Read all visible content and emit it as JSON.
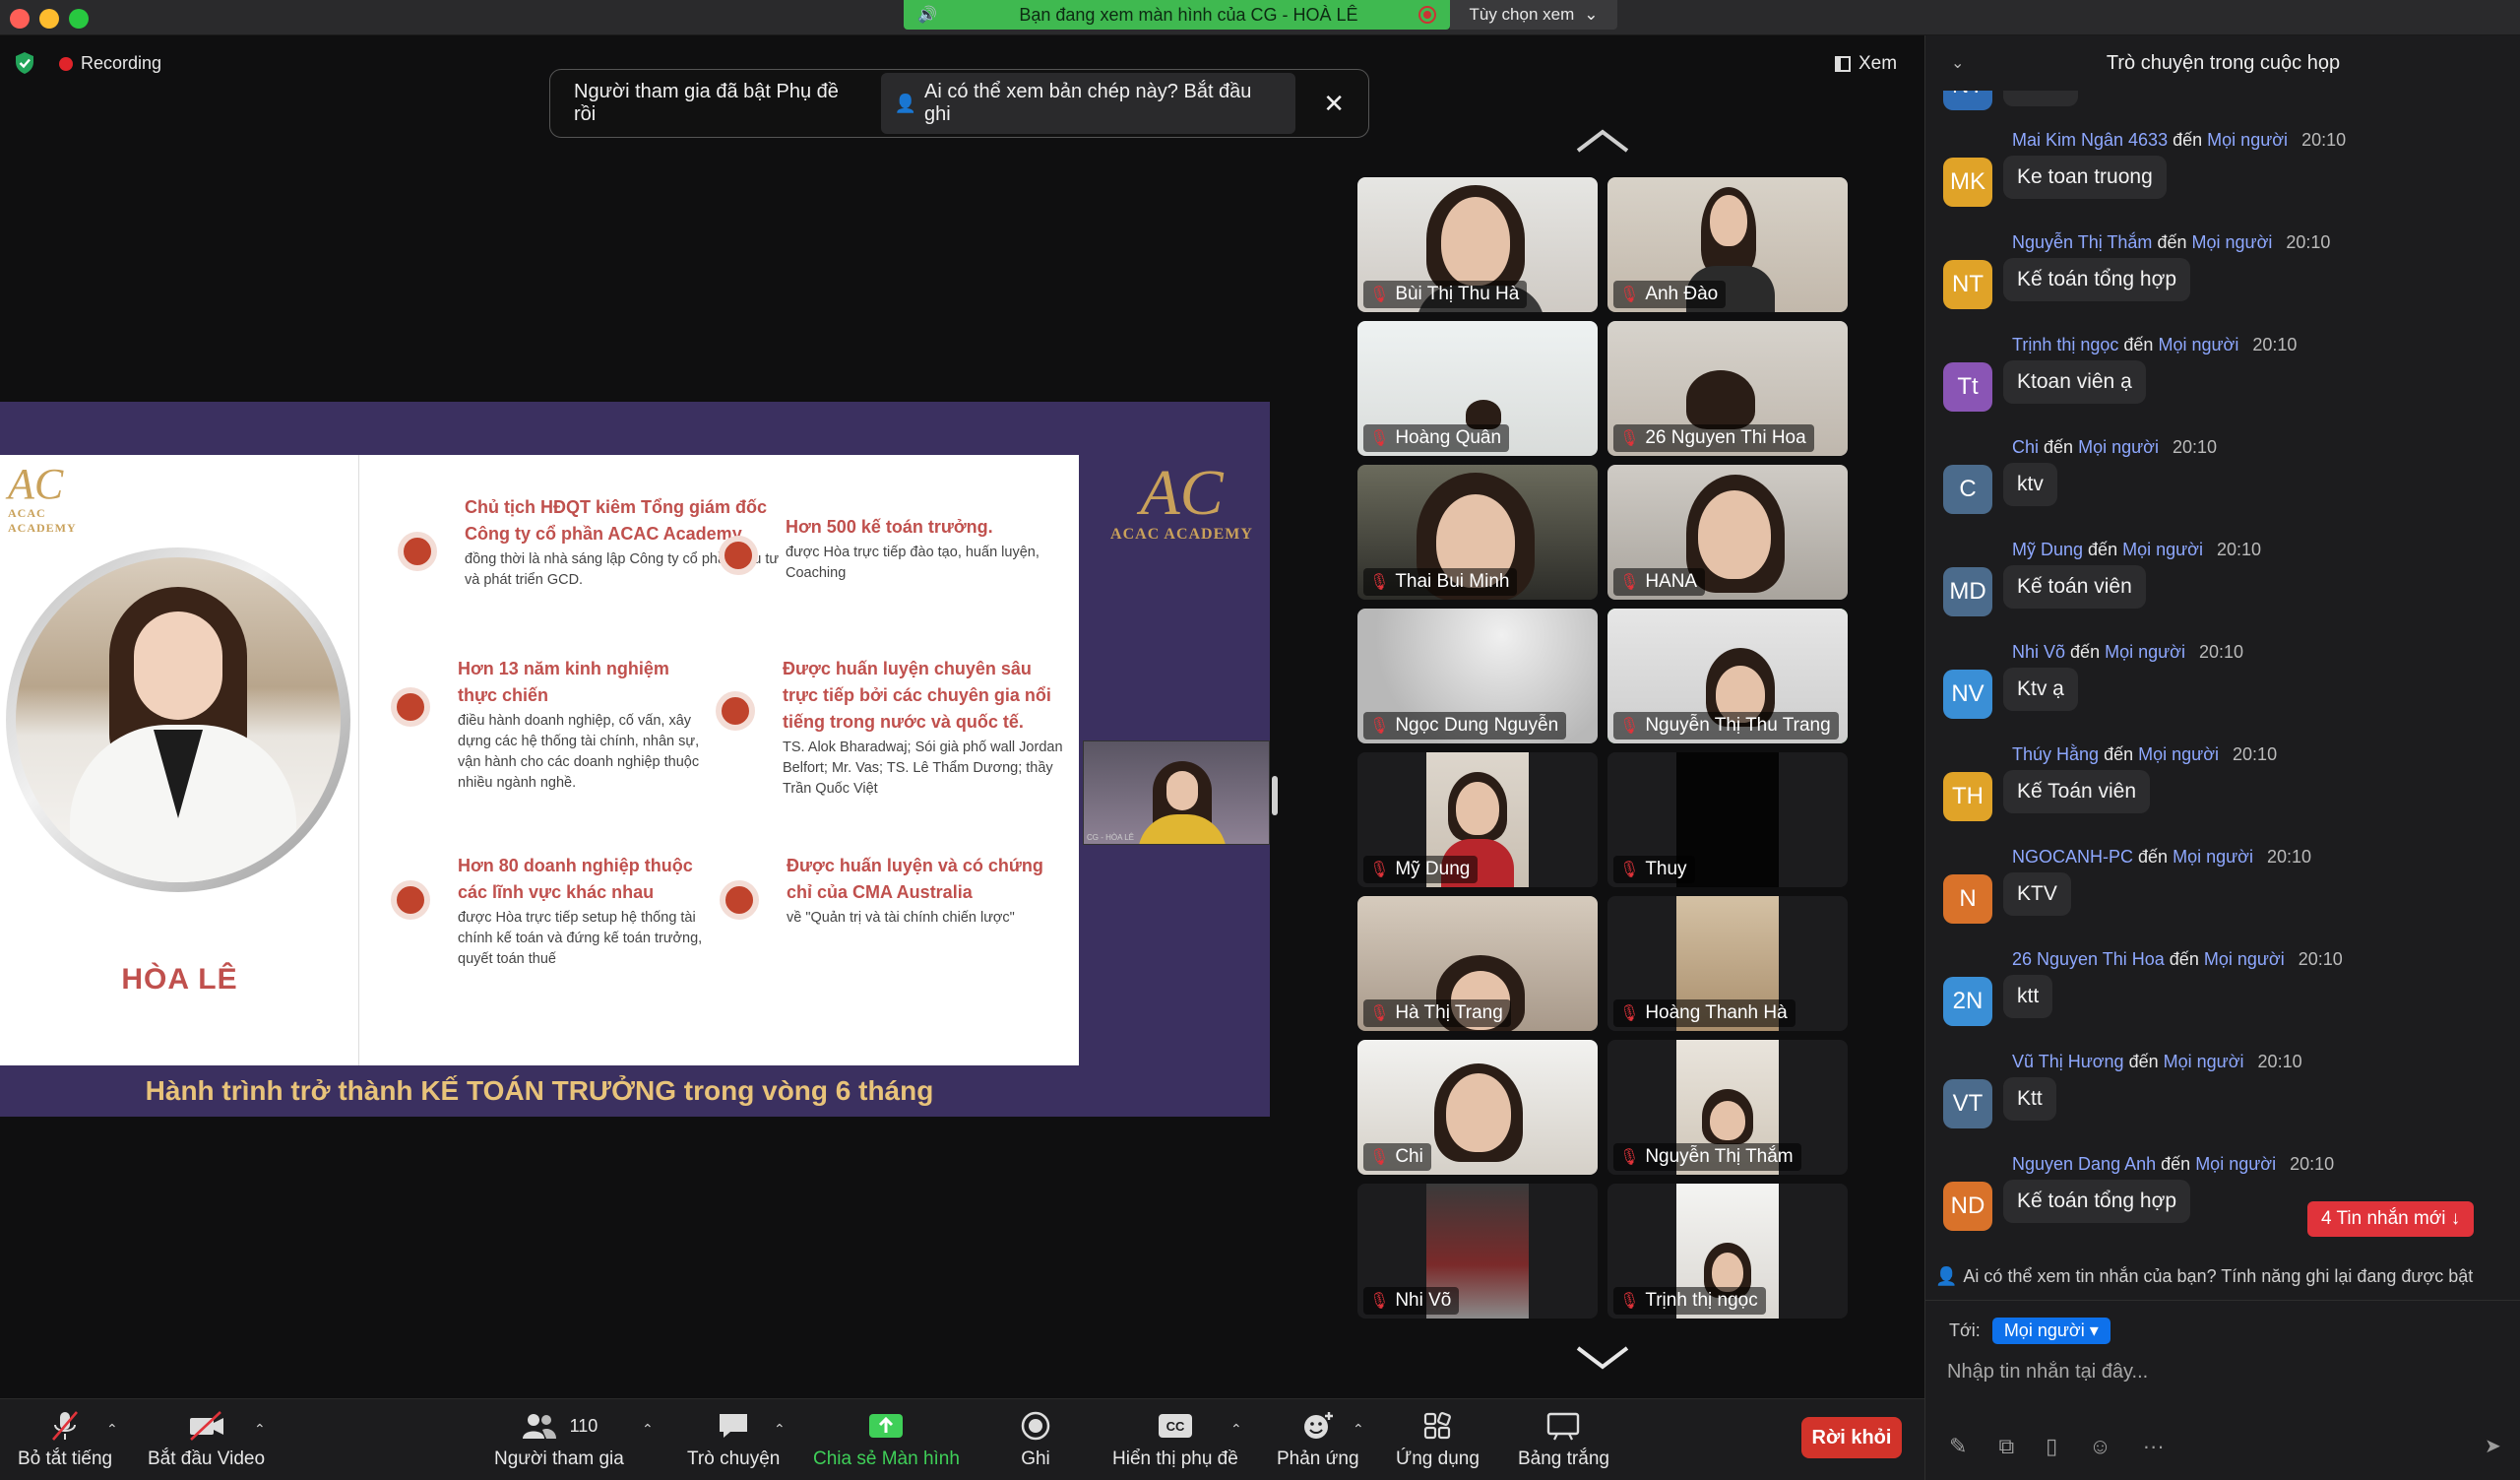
{
  "window": {
    "share_banner": "Bạn đang xem màn hình của CG - HOÀ LÊ",
    "view_options": "Tùy chọn xem"
  },
  "meeting": {
    "recording": "Recording",
    "view_label": "Xem",
    "caption_notice": "Người tham gia đã bật Phụ đề rồi",
    "caption_btn": "Ai có thể xem bản chép này? Bắt đầu ghi"
  },
  "slide": {
    "logo_name": "ACAC ACADEMY",
    "speaker": "HÒA LÊ",
    "footer": "Hành trình trở thành KẾ TOÁN TRƯỞNG trong vòng 6 tháng",
    "features": [
      {
        "title": "Chủ tịch HĐQT kiêm Tổng giám đốc Công ty cổ phần ACAC Academy",
        "desc": "đồng thời là nhà sáng lập Công ty cổ phần đầu tư và phát triển GCD."
      },
      {
        "title": "Hơn 500 kế toán trưởng.",
        "desc": "được Hòa trực tiếp đào tạo, huấn luyện, Coaching"
      },
      {
        "title": "Hơn 13 năm kinh nghiệm thực chiến",
        "desc": "điều hành doanh nghiệp, cố vấn, xây dựng các hệ thống tài chính, nhân sự, vận hành cho các doanh nghiệp thuộc nhiều ngành nghề."
      },
      {
        "title": "Được huấn luyện chuyên sâu trực tiếp bởi các chuyên gia nổi tiếng trong nước và quốc tế.",
        "desc": "TS. Alok Bharadwaj; Sói già phố wall Jordan Belfort; Mr. Vas; TS. Lê Thẩm Dương; thầy Trần Quốc Việt"
      },
      {
        "title": "Hơn 80 doanh nghiệp thuộc các lĩnh vực khác nhau",
        "desc": "được Hòa trực tiếp setup hệ thống tài chính kế toán và đứng kế toán trưởng, quyết toán thuế"
      },
      {
        "title": "Được huấn luyện và có chứng chỉ của CMA Australia",
        "desc": "về \"Quản trị và tài chính chiến lược\""
      }
    ],
    "pip_label": "CG - HÒA LÊ"
  },
  "participants": [
    {
      "name": "Bùi Thị Thu Hà"
    },
    {
      "name": "Anh Đào"
    },
    {
      "name": "Hoàng Quân"
    },
    {
      "name": "26 Nguyen Thi Hoa"
    },
    {
      "name": "Thai Bui Minh"
    },
    {
      "name": "HANA"
    },
    {
      "name": "Ngọc Dung Nguyễn"
    },
    {
      "name": "Nguyễn Thị Thu Trang"
    },
    {
      "name": "Mỹ Dung"
    },
    {
      "name": "Thuy"
    },
    {
      "name": "Hà Thị Trang"
    },
    {
      "name": "Hoàng Thanh Hà"
    },
    {
      "name": "Chi"
    },
    {
      "name": "Nguyễn Thị Thắm"
    },
    {
      "name": "Nhi Võ"
    },
    {
      "name": "Trịnh thị ngọc"
    }
  ],
  "toolbar": {
    "mute": "Bỏ tắt tiếng",
    "video": "Bắt đầu Video",
    "participants": "Người tham gia",
    "participants_count": "110",
    "chat": "Trò chuyện",
    "share": "Chia sẻ Màn hình",
    "record": "Ghi",
    "captions": "Hiển thị phụ đề",
    "reactions": "Phản ứng",
    "apps": "Ứng dụng",
    "whiteboard": "Bảng trắng",
    "leave": "Rời khỏi"
  },
  "chat": {
    "title": "Trò chuyện trong cuộc họp",
    "to_word": "đến",
    "audience": "Mọi người",
    "messages": [
      {
        "initials": "NT",
        "color": "#2f6cb5",
        "sender": "",
        "time": "",
        "text": "chưa"
      },
      {
        "initials": "MK",
        "color": "#e0a328",
        "sender": "Mai Kim Ngân 4633",
        "time": "20:10",
        "text": "Ke toan truong"
      },
      {
        "initials": "NT",
        "color": "#e0a328",
        "sender": "Nguyễn Thị Thắm",
        "time": "20:10",
        "text": "Kế toán tổng hợp"
      },
      {
        "initials": "Tt",
        "color": "#8a55b5",
        "sender": "Trịnh thị ngọc",
        "time": "20:10",
        "text": "Ktoan viên ạ"
      },
      {
        "initials": "C",
        "color": "#4b6b8c",
        "sender": "Chi",
        "time": "20:10",
        "text": "ktv"
      },
      {
        "initials": "MD",
        "color": "#4b6b8c",
        "sender": "Mỹ Dung",
        "time": "20:10",
        "text": "Kế toán viên"
      },
      {
        "initials": "NV",
        "color": "#3a8fd6",
        "sender": "Nhi Võ",
        "time": "20:10",
        "text": "Ktv ạ"
      },
      {
        "initials": "TH",
        "color": "#e0a328",
        "sender": "Thúy Hằng",
        "time": "20:10",
        "text": "Kế Toán viên"
      },
      {
        "initials": "N",
        "color": "#d9722a",
        "sender": "NGOCANH-PC",
        "time": "20:10",
        "text": "KTV"
      },
      {
        "initials": "2N",
        "color": "#3a8fd6",
        "sender": "26 Nguyen Thi Hoa",
        "time": "20:10",
        "text": "ktt"
      },
      {
        "initials": "VT",
        "color": "#4b6b8c",
        "sender": "Vũ Thị Hương",
        "time": "20:10",
        "text": "Ktt"
      },
      {
        "initials": "ND",
        "color": "#d9722a",
        "sender": "Nguyen Dang Anh",
        "time": "20:10",
        "text": "Kế toán tổng hợp"
      }
    ],
    "new_messages": "4 Tin nhắn mới ↓",
    "transcript_note": "Ai có thể xem tin nhắn của bạn? Tính năng ghi lại đang được bật",
    "to_label": "Tới:",
    "placeholder": "Nhập tin nhắn tại đây..."
  }
}
